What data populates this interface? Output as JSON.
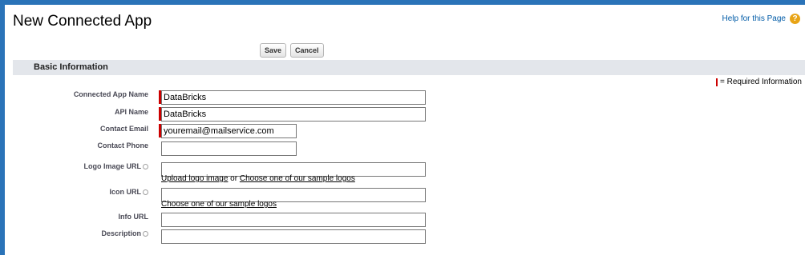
{
  "header": {
    "title": "New Connected App",
    "help_link": "Help for this Page",
    "help_icon": "question-circle-icon"
  },
  "toolbar": {
    "save_label": "Save",
    "cancel_label": "Cancel"
  },
  "section": {
    "title": "Basic Information",
    "required_legend": "= Required Information",
    "required_color": "#cc0000"
  },
  "fields": {
    "app_name": {
      "label": "Connected App Name",
      "value": "DataBricks"
    },
    "api_name": {
      "label": "API Name",
      "value": "DataBricks"
    },
    "contact_email": {
      "label": "Contact Email",
      "value": "youremail@mailservice.com"
    },
    "contact_phone": {
      "label": "Contact Phone",
      "value": ""
    },
    "logo_url": {
      "label": "Logo Image URL",
      "value": "",
      "upload_link": "Upload logo image",
      "or_text": "or",
      "sample_link": "Choose one of our sample logos"
    },
    "icon_url": {
      "label": "Icon URL",
      "value": "",
      "sample_link": "Choose one of our sample logos"
    },
    "info_url": {
      "label": "Info URL",
      "value": ""
    },
    "description": {
      "label": "Description",
      "value": ""
    }
  },
  "colors": {
    "accent": "#2a73b8",
    "section_bg": "#e3e6eb"
  }
}
